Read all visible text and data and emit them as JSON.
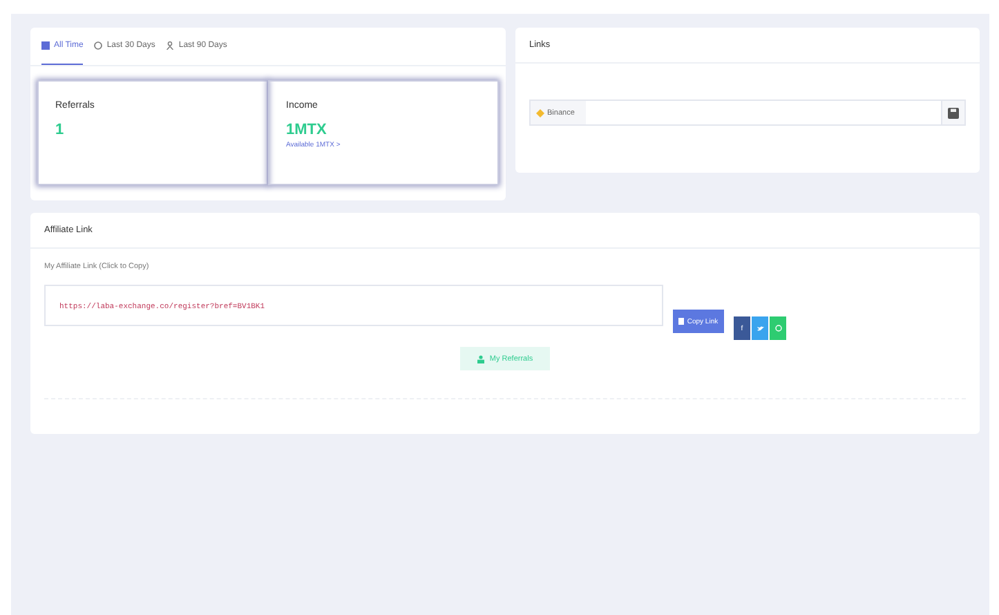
{
  "tabs": [
    {
      "label": "All Time",
      "selected": true
    },
    {
      "label": "Last 30 Days",
      "selected": false
    },
    {
      "label": "Last 90 Days",
      "selected": false
    }
  ],
  "stats": [
    {
      "label": "Referrals",
      "value": "1"
    },
    {
      "label": "Income",
      "value": "1MTX",
      "note": "Available 1MTX >"
    }
  ],
  "links_card": {
    "title": "Links",
    "exchange": "Binance"
  },
  "affiliate": {
    "title": "Affiliate Link",
    "hint": "My Affiliate Link (Click to Copy)",
    "url": "https://laba-exchange.co/register?bref=BV1BK1",
    "copy_button": "Copy Link",
    "share": [
      {
        "label": "f",
        "kind": "facebook"
      },
      {
        "kind": "twitter"
      },
      {
        "kind": "whatsapp"
      }
    ],
    "referrals_button": "My Referrals"
  }
}
